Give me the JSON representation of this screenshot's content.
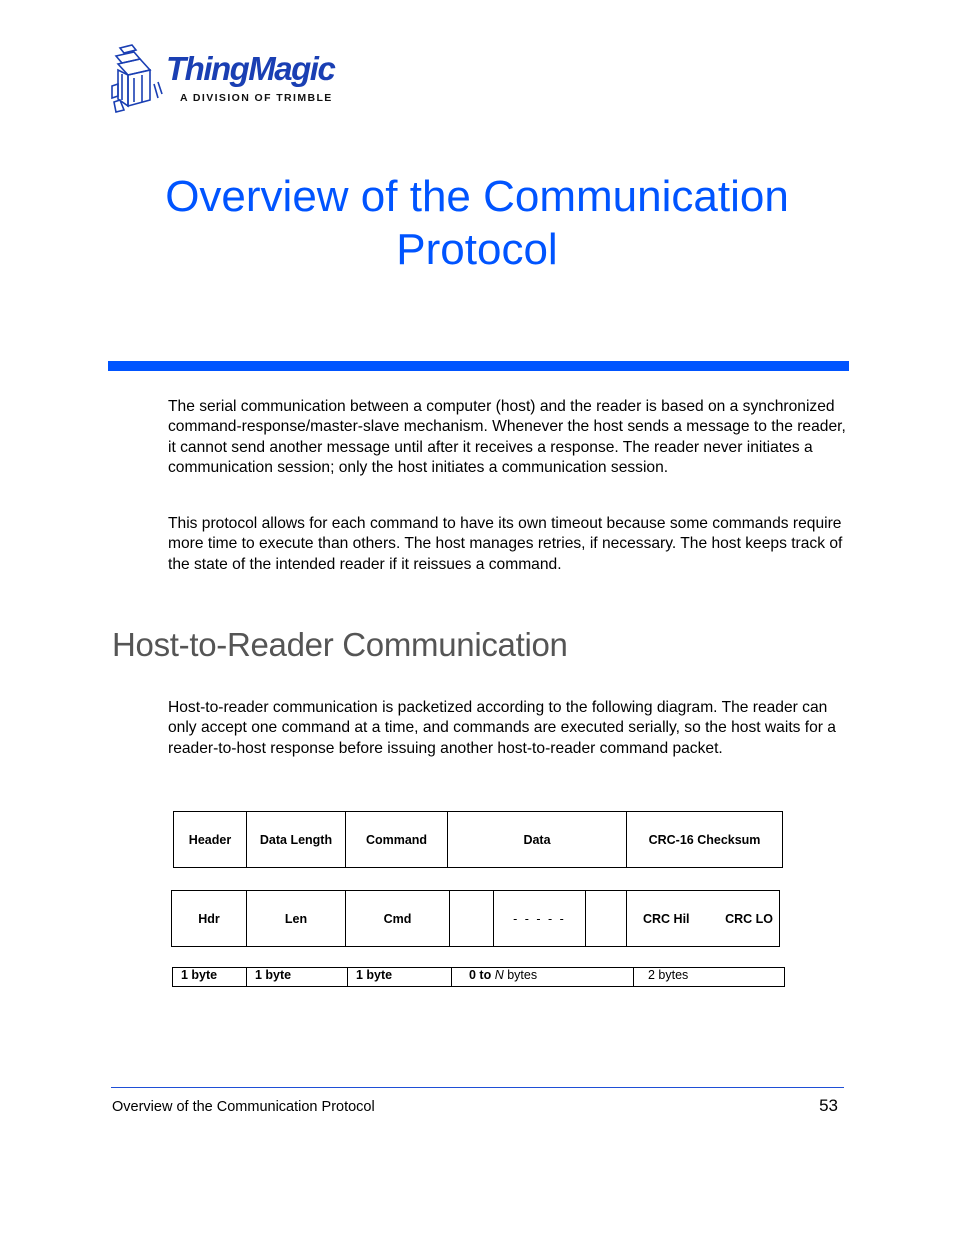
{
  "logo": {
    "icon": "cube-stack-icon",
    "name": "ThingMagic",
    "subtitle": "A DIVISION OF TRIMBLE",
    "brand_color": "#1a3fb3"
  },
  "title": {
    "line1": "Overview of the Communication",
    "line2": "Protocol",
    "color": "#0054ff"
  },
  "intro": {
    "paragraphs": [
      "The serial communication between a computer (host) and the reader is based on a synchronized command-response/master-slave mechanism. Whenever the host sends a message to the reader, it cannot send another message until after it receives a response. The reader never initiates a communication session; only the host initiates a communication session.",
      "This protocol allows for each command to have its own timeout because some commands require more time to execute than others. The host manages retries, if necessary. The host keeps track of the state of the intended reader if it reissues a command."
    ]
  },
  "section": {
    "heading": "Host-to-Reader Communication",
    "paragraph": "Host-to-reader communication is packetized according to the following diagram. The reader can only accept one command at a time, and commands are executed serially, so the host waits for a reader-to-host response before issuing another host-to-reader command packet."
  },
  "packet_diagram": {
    "fields": [
      "Header",
      "Data Length",
      "Command",
      "Data",
      "CRC-16 Checksum"
    ],
    "abbreviations": {
      "hdr": "Hdr",
      "len": "Len",
      "cmd": "Cmd",
      "data_ellipsis": "- - - - -",
      "crc_hi": "CRC Hil",
      "crc_lo": "CRC LO"
    },
    "sizes": {
      "header": "1 byte",
      "length": "1 byte",
      "command": "1 byte",
      "data_prefix": "0 to",
      "data_n": "N",
      "data_suffix": " bytes",
      "crc": "2 bytes"
    }
  },
  "footer": {
    "section_title": "Overview of the Communication Protocol",
    "page_number": "53",
    "rule_color": "#1f4fd6"
  }
}
